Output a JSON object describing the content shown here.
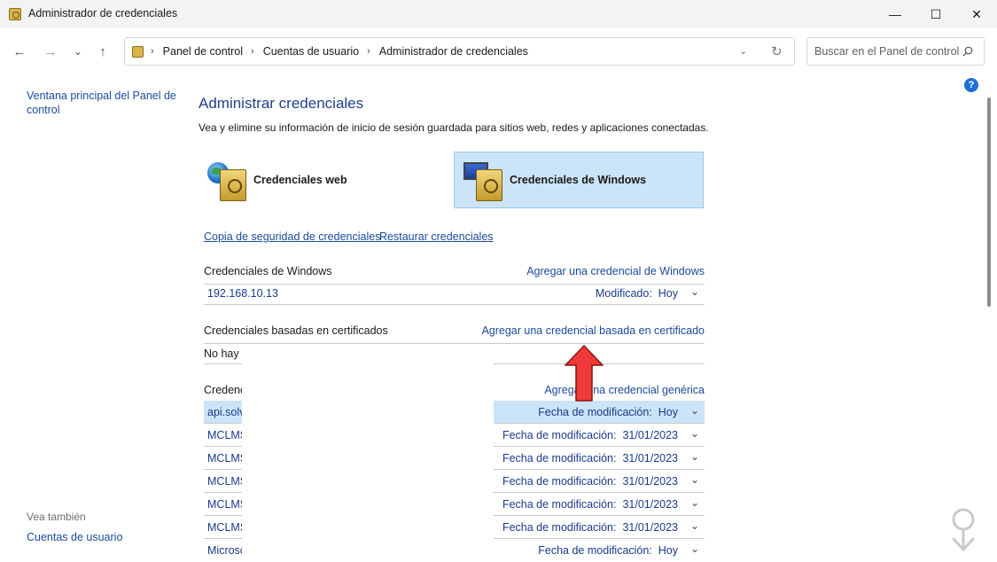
{
  "window": {
    "title": "Administrador de credenciales",
    "minimize_glyph": "—",
    "maximize_glyph": "☐",
    "close_glyph": "✕"
  },
  "nav": {
    "back_glyph": "←",
    "forward_glyph": "→",
    "recent_glyph": "⌄",
    "up_glyph": "↑",
    "breadcrumbs": [
      "Panel de control",
      "Cuentas de usuario",
      "Administrador de credenciales"
    ],
    "crumb_separator": "›",
    "dropdown_glyph": "⌄",
    "refresh_glyph": "↻",
    "search_placeholder": "Buscar en el Panel de control"
  },
  "sidebar": {
    "home_link": "Ventana principal del Panel de control",
    "see_also_label": "Vea también",
    "see_also_link": "Cuentas de usuario"
  },
  "main": {
    "help_glyph": "?",
    "title": "Administrar credenciales",
    "description": "Vea y elimine su información de inicio de sesión guardada para sitios web, redes y aplicaciones conectadas.",
    "credential_types": [
      {
        "label": "Credenciales web",
        "selected": false
      },
      {
        "label": "Credenciales de Windows",
        "selected": true
      }
    ],
    "backup_link": "Copia de seguridad de credenciales",
    "restore_link": "Restaurar credenciales",
    "windows_section": {
      "title": "Credenciales de Windows",
      "add_link": "Agregar una credencial de Windows",
      "rows": [
        {
          "name": "192.168.10.13",
          "meta_label": "Modificado:",
          "meta_value": "Hoy"
        }
      ]
    },
    "cert_section": {
      "title": "Credenciales basadas en certificados",
      "add_link": "Agregar una credencial basada en certificado",
      "empty_text": "No hay c"
    },
    "generic_section": {
      "title": "Credenc",
      "add_link": "Agregar una credencial genérica",
      "rows": [
        {
          "name": "api.solv",
          "meta_label": "Fecha de modificación:",
          "meta_value": "Hoy",
          "highlighted": true
        },
        {
          "name": "MCLMS",
          "meta_label": "Fecha de modificación:",
          "meta_value": "31/01/2023",
          "highlighted": false
        },
        {
          "name": "MCLMS",
          "meta_label": "Fecha de modificación:",
          "meta_value": "31/01/2023",
          "highlighted": false
        },
        {
          "name": "MCLMS",
          "meta_label": "Fecha de modificación:",
          "meta_value": "31/01/2023",
          "highlighted": false
        },
        {
          "name": "MCLMS",
          "meta_label": "Fecha de modificación:",
          "meta_value": "31/01/2023",
          "highlighted": false
        },
        {
          "name": "MCLMS",
          "meta_label": "Fecha de modificación:",
          "meta_value": "31/01/2023",
          "highlighted": false
        },
        {
          "name": "Microsc",
          "meta_label": "Fecha de modificación:",
          "meta_value": "Hoy",
          "highlighted": false
        }
      ]
    },
    "chevron_glyph": "⌄"
  },
  "colors": {
    "link": "#1a4a9c",
    "selection": "#cce4f7",
    "annotation_arrow": "#f03a3a"
  }
}
